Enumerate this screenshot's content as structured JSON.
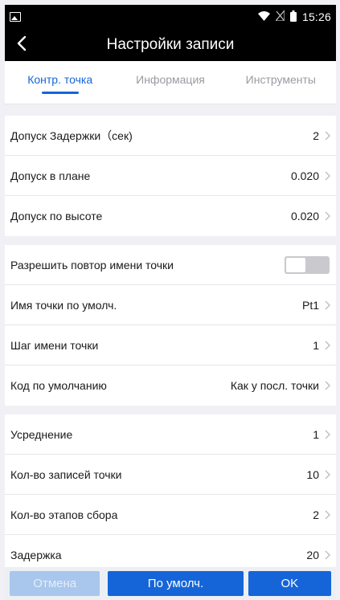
{
  "statusbar": {
    "time": "15:26",
    "icons": [
      "image-icon",
      "wifi-icon",
      "no-sim-icon",
      "battery-icon"
    ]
  },
  "header": {
    "title": "Настройки записи",
    "back_icon": "chevron-left-icon"
  },
  "tabs": [
    {
      "label": "Контр. точка",
      "active": true
    },
    {
      "label": "Информация",
      "active": false
    },
    {
      "label": "Инструменты",
      "active": false
    }
  ],
  "groups": {
    "tolerance": [
      {
        "label": "Допуск Задержки（сек)",
        "value": "2"
      },
      {
        "label": "Допуск в плане",
        "value": "0.020"
      },
      {
        "label": "Допуск по высоте",
        "value": "0.020"
      }
    ],
    "naming": {
      "repeat_label": "Разрешить повтор имени точки",
      "repeat_enabled": false,
      "items": [
        {
          "label": "Имя точки по умолч.",
          "value": "Pt1"
        },
        {
          "label": "Шаг имени точки",
          "value": "1"
        },
        {
          "label": "Код по умолчанию",
          "value": "Как у посл. точки"
        }
      ]
    },
    "collection": [
      {
        "label": "Усреднение",
        "value": "1"
      },
      {
        "label": "Кол-во записей точки",
        "value": "10"
      },
      {
        "label": "Кол-во этапов сбора",
        "value": "2"
      },
      {
        "label": "Задержка",
        "value": "20"
      }
    ]
  },
  "footer": {
    "cancel_label": "Отмена",
    "default_label": "По умолч.",
    "ok_label": "OK"
  },
  "colors": {
    "accent": "#1565d8",
    "accent_disabled": "#a9c6ec",
    "background": "#f0f0f5"
  }
}
